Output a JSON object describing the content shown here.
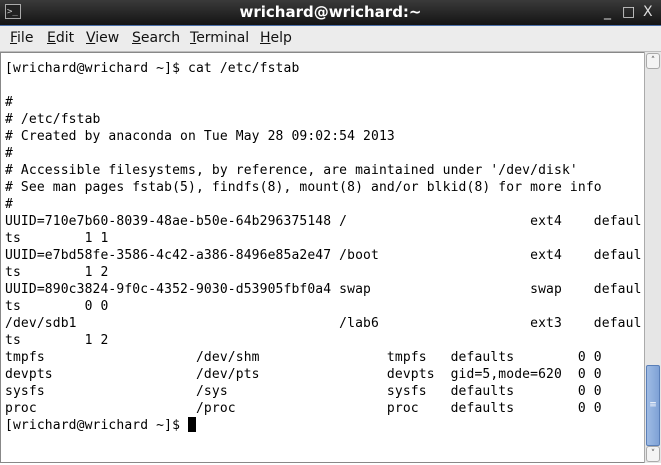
{
  "window": {
    "title": "wrichard@wrichard:~",
    "icon": "terminal-icon",
    "minimize": "_",
    "maximize": "□",
    "close": "X"
  },
  "menu": [
    {
      "label": "File",
      "mnemonic": "F",
      "rest": "ile"
    },
    {
      "label": "Edit",
      "mnemonic": "E",
      "rest": "dit"
    },
    {
      "label": "View",
      "mnemonic": "V",
      "rest": "iew"
    },
    {
      "label": "Search",
      "mnemonic": "S",
      "rest": "earch"
    },
    {
      "label": "Terminal",
      "mnemonic": "T",
      "rest": "erminal"
    },
    {
      "label": "Help",
      "mnemonic": "H",
      "rest": "elp"
    }
  ],
  "terminal": {
    "lines": [
      "[wrichard@wrichard ~]$ cat /etc/fstab",
      "",
      "#",
      "# /etc/fstab",
      "# Created by anaconda on Tue May 28 09:02:54 2013",
      "#",
      "# Accessible filesystems, by reference, are maintained under '/dev/disk'",
      "# See man pages fstab(5), findfs(8), mount(8) and/or blkid(8) for more info",
      "#",
      "UUID=710e7b60-8039-48ae-b50e-64b296375148 /                       ext4    defaul",
      "ts        1 1",
      "UUID=e7bd58fe-3586-4c42-a386-8496e85a2e47 /boot                   ext4    defaul",
      "ts        1 2",
      "UUID=890c3824-9f0c-4352-9030-d53905fbf0a4 swap                    swap    defaul",
      "ts        0 0",
      "/dev/sdb1                                 /lab6                   ext3    defaul",
      "ts        1 2",
      "tmpfs                   /dev/shm                tmpfs   defaults        0 0",
      "devpts                  /dev/pts                devpts  gid=5,mode=620  0 0",
      "sysfs                   /sys                    sysfs   defaults        0 0",
      "proc                    /proc                   proc    defaults        0 0"
    ],
    "prompt": "[wrichard@wrichard ~]$ "
  },
  "scrollbar": {
    "position_fraction": 0.95
  }
}
